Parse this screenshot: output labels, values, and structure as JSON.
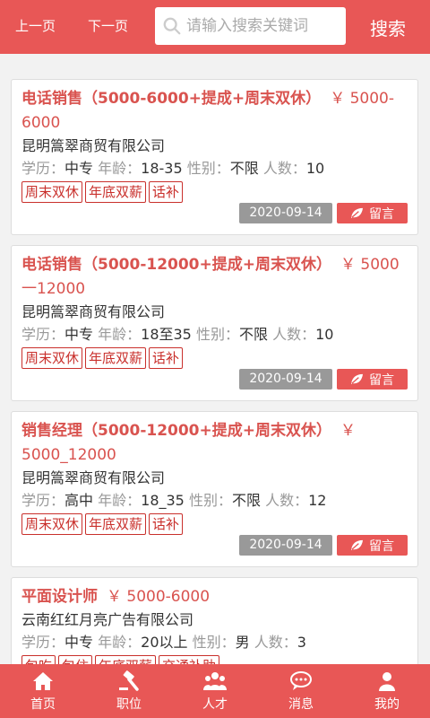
{
  "header": {
    "prev": "上一页",
    "next": "下一页",
    "search_placeholder": "请输入搜索关键词",
    "search_button": "搜索"
  },
  "labels": {
    "education": "学历：",
    "age": "年龄：",
    "gender": "性别：",
    "count": "人数：",
    "message": "留言"
  },
  "jobs": [
    {
      "title": "电话销售（5000-6000+提成+周末双休）",
      "salary": "￥ 5000-6000",
      "company": "昆明篙翠商贸有限公司",
      "education": "中专",
      "age": "18-35",
      "gender": "不限",
      "count": "10",
      "tags": [
        "周末双休",
        "年底双薪",
        "话补"
      ],
      "date": "2020-09-14"
    },
    {
      "title": "电话销售（5000-12000+提成+周末双休）",
      "salary": "￥ 5000一12000",
      "company": "昆明篙翠商贸有限公司",
      "education": "中专",
      "age": "18至35",
      "gender": "不限",
      "count": "10",
      "tags": [
        "周末双休",
        "年底双薪",
        "话补"
      ],
      "date": "2020-09-14"
    },
    {
      "title": "销售经理（5000-12000+提成+周末双休）",
      "salary": "￥ 5000_12000",
      "company": "昆明篙翠商贸有限公司",
      "education": "高中",
      "age": "18_35",
      "gender": "不限",
      "count": "12",
      "tags": [
        "周末双休",
        "年底双薪",
        "话补"
      ],
      "date": "2020-09-14"
    },
    {
      "title": "平面设计师",
      "salary": "￥ 5000-6000",
      "company": "云南红红月亮广告有限公司",
      "education": "中专",
      "age": "20以上",
      "gender": "男",
      "count": "3",
      "tags": [
        "包吃",
        "包住",
        "年底双薪",
        "交通补助"
      ],
      "date": ""
    }
  ],
  "tabbar": [
    {
      "label": "首页",
      "icon": "home-icon"
    },
    {
      "label": "职位",
      "icon": "gavel-icon"
    },
    {
      "label": "人才",
      "icon": "users-icon"
    },
    {
      "label": "消息",
      "icon": "chat-icon"
    },
    {
      "label": "我的",
      "icon": "user-icon"
    }
  ],
  "colors": {
    "primary": "#e85756",
    "title": "#d9534f",
    "date_badge": "#999999"
  }
}
